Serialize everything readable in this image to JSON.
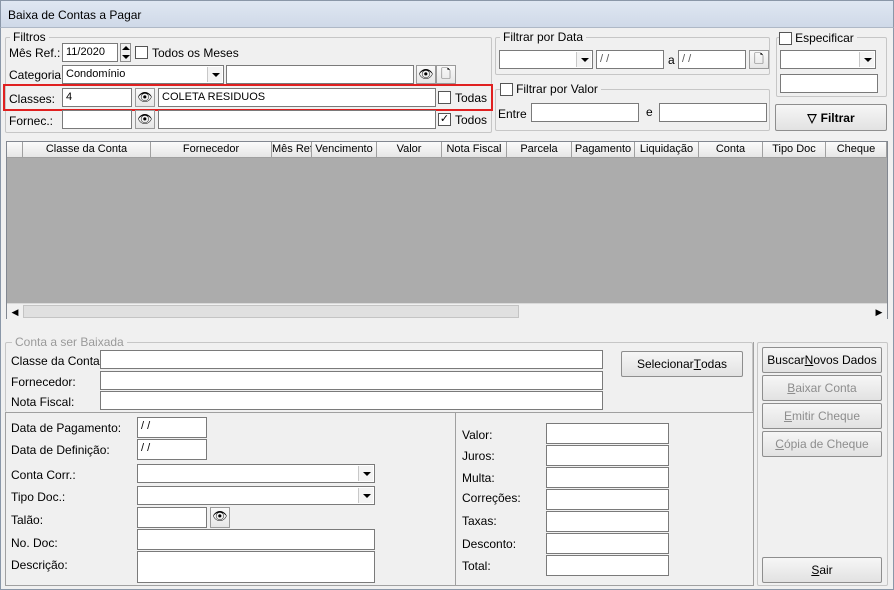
{
  "window": {
    "title": "Baixa de Contas a Pagar"
  },
  "filtros": {
    "legend": "Filtros",
    "mes_ref_label": "Mês Ref.:",
    "mes_ref_value": "11/2020",
    "todos_meses_label": "Todos os Meses",
    "categoria_label": "Categoria:",
    "categoria_value": "Condomínio",
    "categoria_text": "",
    "classes_label": "Classes:",
    "classes_code": "4",
    "classes_name": "COLETA RESIDUOS",
    "todas_label": "Todas",
    "fornec_label": "Fornec.:",
    "fornec_code": "",
    "fornec_name": "",
    "todos_label": "Todos",
    "todos_checked": "✓"
  },
  "filtrar_data": {
    "legend": "Filtrar por Data",
    "date_from": "/ /",
    "a_label": "a",
    "date_to": "/ /"
  },
  "filtrar_valor": {
    "legend": "Filtrar por Valor",
    "entre_label": "Entre",
    "e_label": "e"
  },
  "especificar": {
    "legend": "Especificar"
  },
  "filtrar_button": "Filtrar",
  "grid": {
    "columns": [
      "Classe da Conta",
      "Fornecedor",
      "Mês Ref",
      "Vencimento",
      "Valor",
      "Nota Fiscal",
      "Parcela",
      "Pagamento",
      "Liquidação",
      "Conta",
      "Tipo Doc",
      "Cheque"
    ]
  },
  "conta_baixada": {
    "legend": "Conta a ser Baixada",
    "classe_label": "Classe da Conta:",
    "fornecedor_label": "Fornecedor:",
    "nota_label": "Nota Fiscal:",
    "selecionar_button_pre": "Selecionar ",
    "selecionar_button_u": "T",
    "selecionar_button_post": "odas",
    "data_pag_label": "Data de Pagamento:",
    "data_pag_value": "/ /",
    "data_def_label": "Data de Definição:",
    "data_def_value": "/ /",
    "conta_corr_label": "Conta Corr.:",
    "tipo_doc_label": "Tipo Doc.:",
    "talao_label": "Talão:",
    "no_doc_label": "No. Doc:",
    "descricao_label": "Descrição:",
    "valor_label": "Valor:",
    "juros_label": "Juros:",
    "multa_label": "Multa:",
    "correcoes_label": "Correções:",
    "taxas_label": "Taxas:",
    "desconto_label": "Desconto:",
    "total_label": "Total:"
  },
  "actions": {
    "buscar_pre": "Buscar ",
    "buscar_u": "N",
    "buscar_post": "ovos Dados",
    "baixar_u": "B",
    "baixar_post": "aixar Conta",
    "emitir_u": "E",
    "emitir_post": "mitir Cheque",
    "copia_u": "C",
    "copia_post": "ópia de Cheque",
    "sair_u": "S",
    "sair_post": "air"
  },
  "colors": {
    "highlight": "#e02020",
    "grid_bg": "#acacac"
  }
}
